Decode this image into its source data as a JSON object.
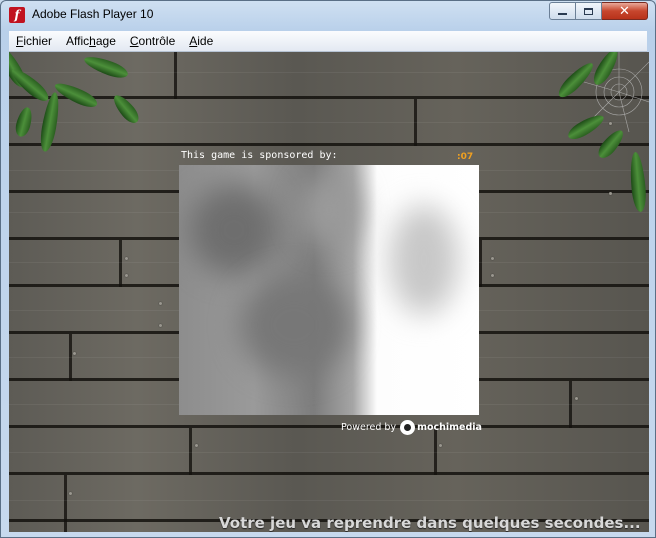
{
  "window": {
    "title": "Adobe Flash Player 10",
    "app_icon": "flash-icon",
    "controls": [
      "minimize-icon",
      "maximize-icon",
      "close-icon"
    ]
  },
  "menu": {
    "items": [
      {
        "label": "Fichier",
        "accel": "F",
        "rest": "ichier"
      },
      {
        "label": "Affichage",
        "pre": "Affic",
        "accel": "h",
        "rest": "age"
      },
      {
        "label": "Contrôle",
        "accel": "C",
        "rest": "ontrôle"
      },
      {
        "label": "Aide",
        "accel": "A",
        "rest": "ide"
      }
    ]
  },
  "stage": {
    "sponsor_label": "This game is sponsored by:",
    "countdown": ":07",
    "powered_by_label": "Powered by",
    "powered_by_brand": "mochimedia",
    "resume_message": "Votre jeu va reprendre dans quelques secondes...",
    "countdown_color": "#f0a020",
    "background": "wood-planks",
    "decoration": [
      "leaves-top-left",
      "leaves-top-right",
      "spider-web"
    ]
  }
}
